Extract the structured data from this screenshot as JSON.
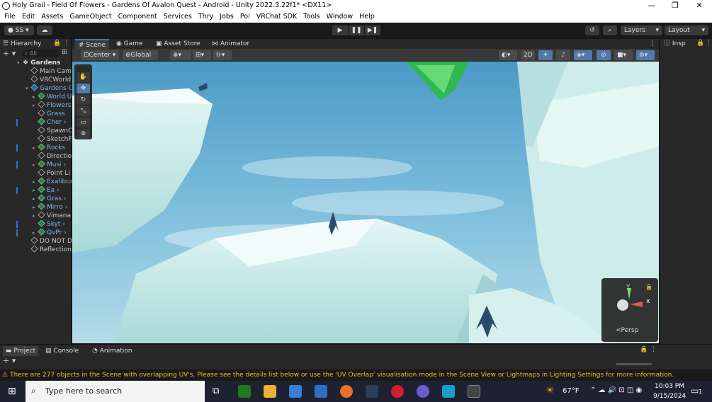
{
  "window": {
    "title": "Holy Grail - Field Of Flowers - Gardens Of Avalon Quest - Android - Unity 2022.3.22f1* <DX11>",
    "controls": [
      "—",
      "❐",
      "✕"
    ]
  },
  "menu": [
    "File",
    "Edit",
    "Assets",
    "GameObject",
    "Component",
    "Services",
    "Thry",
    "Jobs",
    "Poi",
    "VRChat SDK",
    "Tools",
    "Window",
    "Help"
  ],
  "toolbar": {
    "account": "SS",
    "account_caret": "▾",
    "layers": "Layers",
    "layout": "Layout",
    "play_icons": [
      "▶",
      "❚❚",
      "▶❚"
    ]
  },
  "hierarchy": {
    "tab": "Hierarchy",
    "search_placeholder": "All",
    "rows": [
      {
        "label": "Gardens",
        "kind": "scene"
      },
      {
        "label": "Main Cam",
        "kind": "obj"
      },
      {
        "label": "VRCWorld",
        "kind": "obj"
      },
      {
        "label": "Gardens O",
        "kind": "prefab"
      },
      {
        "label": "World U",
        "kind": "prefab"
      },
      {
        "label": "Flowers",
        "kind": "prefab"
      },
      {
        "label": "Grass",
        "kind": "prefab"
      },
      {
        "label": "Cher",
        "kind": "prefab"
      },
      {
        "label": "SpawnO",
        "kind": "obj"
      },
      {
        "label": "SketchF",
        "kind": "obj"
      },
      {
        "label": "Rocks",
        "kind": "prefab"
      },
      {
        "label": "Directio",
        "kind": "obj"
      },
      {
        "label": "Musi",
        "kind": "prefab"
      },
      {
        "label": "Point Li",
        "kind": "obj"
      },
      {
        "label": "Exalibur",
        "kind": "prefab"
      },
      {
        "label": "Ea",
        "kind": "prefab"
      },
      {
        "label": "Gras",
        "kind": "prefab"
      },
      {
        "label": "Mirro",
        "kind": "prefab"
      },
      {
        "label": "Vimana",
        "kind": "obj"
      },
      {
        "label": "Skyt",
        "kind": "prefab"
      },
      {
        "label": "QvPr",
        "kind": "prefab"
      },
      {
        "label": "DO NOT D",
        "kind": "obj"
      },
      {
        "label": "Reflection",
        "kind": "obj"
      }
    ]
  },
  "scene_tabs": [
    "Scene",
    "Game",
    "Asset Store",
    "Animator"
  ],
  "scene_toolbar": {
    "pivot": "Center",
    "space": "Global",
    "mode2d": "2D"
  },
  "gizmo": {
    "persp": "Persp",
    "y": "y",
    "x": "x"
  },
  "inspector": {
    "tab": "Insp"
  },
  "bottom_tabs": [
    "Project",
    "Console",
    "Animation"
  ],
  "status": {
    "message": "There are 277 objects in the Scene with overlapping UV's. Please see the details list below or use the 'UV Overlap' visualisation mode in the Scene View or Lightmaps in Lighting Settings for more information."
  },
  "taskbar": {
    "search_placeholder": "Type here to search",
    "weather": "67°F",
    "time": "10:03 PM",
    "date": "9/15/2024",
    "notif_count": "1"
  }
}
